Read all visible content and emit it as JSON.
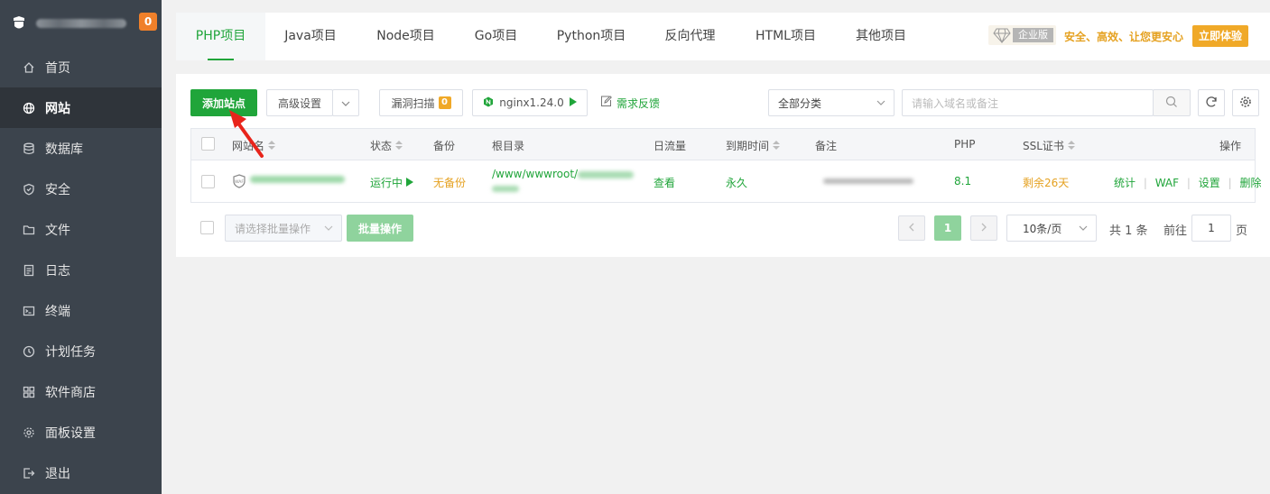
{
  "sidebar": {
    "badge": "0",
    "items": [
      {
        "label": "首页",
        "icon": "home-icon"
      },
      {
        "label": "网站",
        "icon": "globe-icon",
        "active": true
      },
      {
        "label": "数据库",
        "icon": "database-icon"
      },
      {
        "label": "安全",
        "icon": "shield-icon"
      },
      {
        "label": "文件",
        "icon": "folder-icon"
      },
      {
        "label": "日志",
        "icon": "log-icon"
      },
      {
        "label": "终端",
        "icon": "terminal-icon"
      },
      {
        "label": "计划任务",
        "icon": "clock-icon"
      },
      {
        "label": "软件商店",
        "icon": "apps-icon"
      },
      {
        "label": "面板设置",
        "icon": "gear-icon"
      },
      {
        "label": "退出",
        "icon": "logout-icon"
      }
    ]
  },
  "tabs": [
    "PHP项目",
    "Java项目",
    "Node项目",
    "Go项目",
    "Python项目",
    "反向代理",
    "HTML项目",
    "其他项目"
  ],
  "promo": {
    "edition": "企业版",
    "slogan": "安全、高效、让您更安心",
    "try_label": "立即体验"
  },
  "toolbar": {
    "add_site": "添加站点",
    "advanced": "高级设置",
    "vuln_scan": "漏洞扫描",
    "vuln_count": "0",
    "nginx": "nginx1.24.0",
    "feedback": "需求反馈",
    "category": "全部分类",
    "search_placeholder": "请输入域名或备注"
  },
  "table": {
    "headers": {
      "site": "网站名",
      "status": "状态",
      "backup": "备份",
      "root": "根目录",
      "traffic": "日流量",
      "expire": "到期时间",
      "note": "备注",
      "php": "PHP",
      "ssl": "SSL证书",
      "ops": "操作"
    },
    "rows": [
      {
        "site": "",
        "status": "运行中",
        "backup": "无备份",
        "root_prefix": "/www/wwwroot/",
        "traffic": "查看",
        "expire": "永久",
        "php": "8.1",
        "ssl": "剩余26天",
        "ops": [
          "统计",
          "WAF",
          "设置",
          "删除"
        ]
      }
    ]
  },
  "footer": {
    "batch_placeholder": "请选择批量操作",
    "batch_button": "批量操作",
    "current_page": "1",
    "page_size": "10条/页",
    "total": "共 1 条",
    "goto_label": "前往",
    "goto_value": "1",
    "page_unit": "页"
  },
  "colors": {
    "brand_green": "#20a53a",
    "orange": "#e5a120",
    "sidebar_bg": "#3c444d"
  }
}
